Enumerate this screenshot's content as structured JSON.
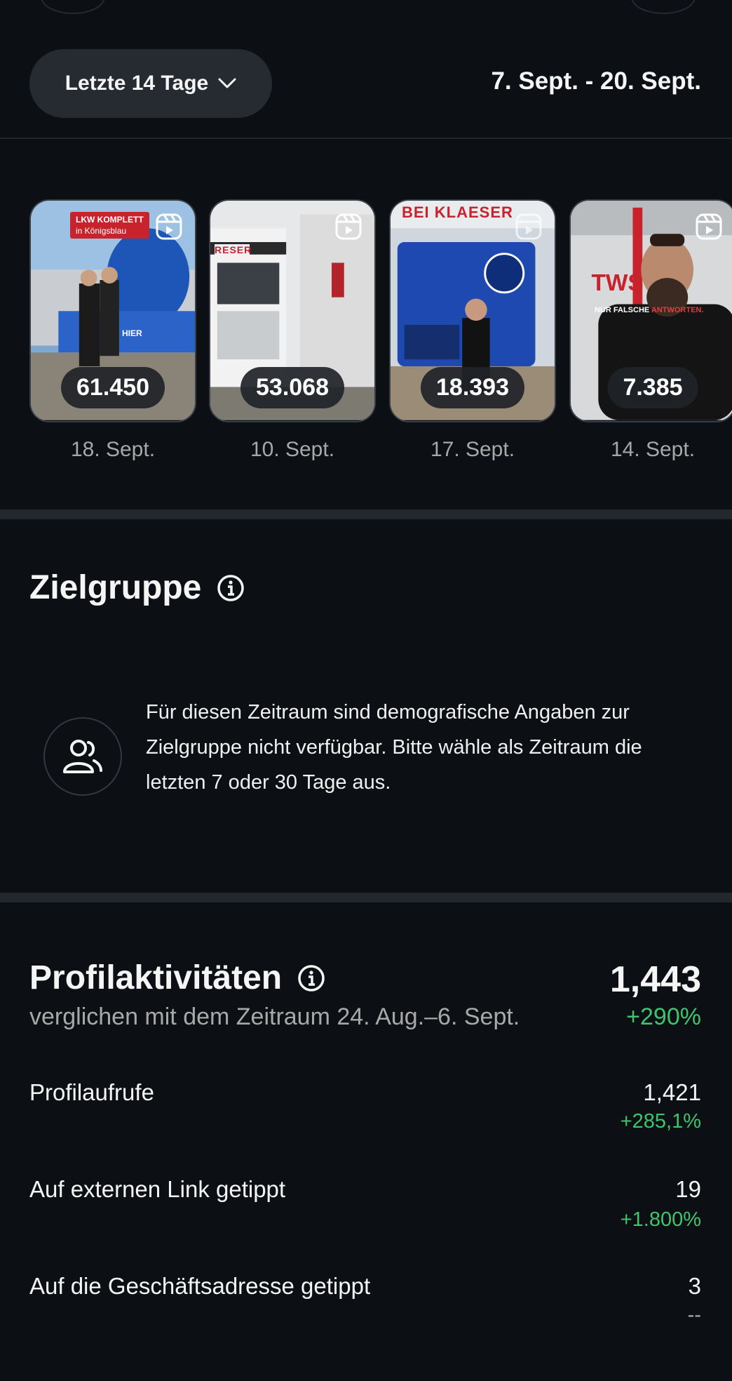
{
  "header": {
    "range_label": "Letzte 14 Tage",
    "range_dates": "7. Sept. - 20. Sept."
  },
  "reels": [
    {
      "views": "61.450",
      "date": "18. Sept.",
      "overlay_lines": [
        "LKW KOMPLETT",
        "in Königsblau",
        "HIER"
      ]
    },
    {
      "views": "53.068",
      "date": "10. Sept.",
      "overlay_lines": [
        "RESER"
      ]
    },
    {
      "views": "18.393",
      "date": "17. Sept.",
      "overlay_lines": [
        "BEI KLAESER"
      ]
    },
    {
      "views": "7.385",
      "date": "14. Sept.",
      "overlay_lines": [
        "NUR FALSCHE ",
        "ANTWORTEN."
      ]
    }
  ],
  "audience": {
    "title": "Zielgruppe",
    "message": "Für diesen Zeitraum sind demografische Angaben zur Zielgruppe nicht verfügbar. Bitte wähle als Zeitraum die letzten 7 oder 30 Tage aus."
  },
  "profile_activity": {
    "title": "Profilaktivitäten",
    "total": "1,443",
    "total_change": "+290%",
    "compare": "verglichen mit dem Zeitraum 24. Aug.–6. Sept.",
    "metrics": [
      {
        "label": "Profilaufrufe",
        "value": "1,421",
        "change": "+285,1%"
      },
      {
        "label": "Auf externen Link getippt",
        "value": "19",
        "change": "+1.800%"
      },
      {
        "label": "Auf die Geschäftsadresse getippt",
        "value": "3",
        "change": "--"
      }
    ]
  },
  "colors": {
    "background": "#0c1014",
    "positive": "#3ec46d",
    "pill": "#262a31"
  }
}
